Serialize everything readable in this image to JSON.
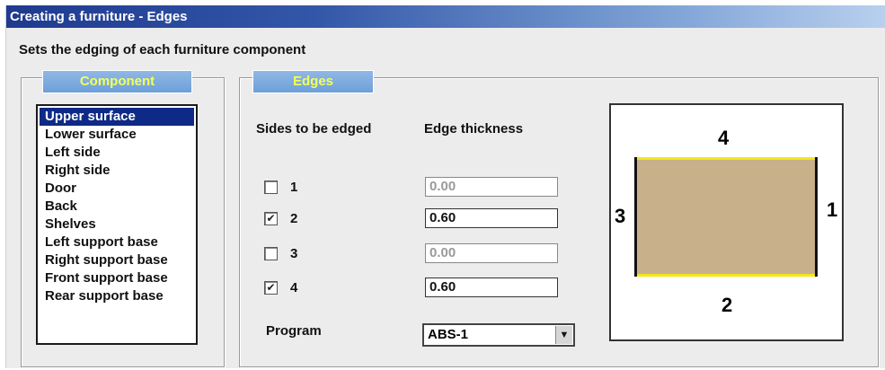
{
  "window": {
    "title": "Creating a furniture - Edges",
    "description": "Sets the edging of each furniture component"
  },
  "component_group": {
    "title": "Component",
    "items": [
      {
        "label": "Upper surface",
        "selected": true
      },
      {
        "label": "Lower surface",
        "selected": false
      },
      {
        "label": "Left side",
        "selected": false
      },
      {
        "label": "Right side",
        "selected": false
      },
      {
        "label": "Door",
        "selected": false
      },
      {
        "label": "Back",
        "selected": false
      },
      {
        "label": "Shelves",
        "selected": false
      },
      {
        "label": "Left support base",
        "selected": false
      },
      {
        "label": "Right support base",
        "selected": false
      },
      {
        "label": "Front support base",
        "selected": false
      },
      {
        "label": "Rear support base",
        "selected": false
      }
    ]
  },
  "edges_group": {
    "title": "Edges",
    "sides_header": "Sides to be edged",
    "thickness_header": "Edge thickness",
    "sides": [
      {
        "label": "1",
        "checked": false,
        "thickness": "0.00",
        "enabled": false
      },
      {
        "label": "2",
        "checked": true,
        "thickness": "0.60",
        "enabled": true
      },
      {
        "label": "3",
        "checked": false,
        "thickness": "0.00",
        "enabled": false
      },
      {
        "label": "4",
        "checked": true,
        "thickness": "0.60",
        "enabled": true
      }
    ],
    "program_label": "Program",
    "program_value": "ABS-1"
  },
  "preview": {
    "top_label": "4",
    "bottom_label": "2",
    "left_label": "3",
    "right_label": "1",
    "board_color": "#c7b08a",
    "edged_color": "#f5e61a",
    "unedged_color": "#111111"
  },
  "colors": {
    "title_bar": "#1f3a8f",
    "selection": "#0f2a86",
    "tab_text": "#f4ff5a"
  }
}
